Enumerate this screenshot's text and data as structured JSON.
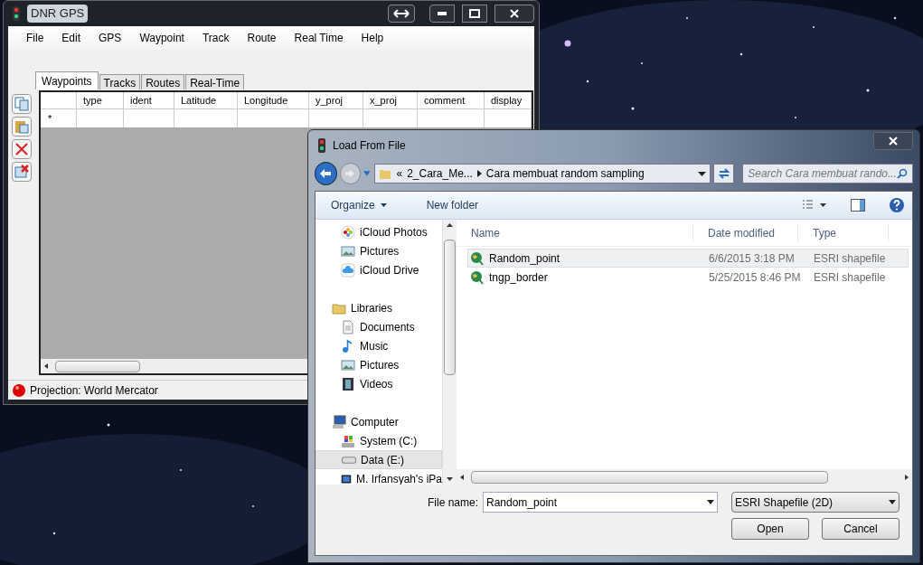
{
  "gps_window": {
    "title": "DNR GPS",
    "menu": [
      "File",
      "Edit",
      "GPS",
      "Waypoint",
      "Track",
      "Route",
      "Real Time",
      "Help"
    ],
    "tabs": [
      {
        "label": "Waypoints",
        "selected": true
      },
      {
        "label": "Tracks",
        "selected": false
      },
      {
        "label": "Routes",
        "selected": false
      },
      {
        "label": "Real-Time",
        "selected": false
      }
    ],
    "table": {
      "columns": [
        "type",
        "ident",
        "Latitude",
        "Longitude",
        "y_proj",
        "x_proj",
        "comment",
        "display"
      ],
      "new_row_marker": "*"
    },
    "status_bar": "Projection: World Mercator"
  },
  "dialog": {
    "title": "Load From File",
    "breadcrumb": {
      "overflow": "«",
      "parent": "2_Cara_Me...",
      "current": "Cara membuat random sampling"
    },
    "search": {
      "placeholder": "Search Cara membuat rando..."
    },
    "toolbar": [
      "Organize",
      "New folder"
    ],
    "nav": [
      {
        "label": "iCloud Photos",
        "kind": "photos",
        "selected": false
      },
      {
        "label": "Pictures",
        "kind": "pictures",
        "selected": false
      },
      {
        "label": "iCloud Drive",
        "kind": "cloud",
        "selected": false
      },
      {
        "label": "Libraries",
        "kind": "library",
        "selected": false
      },
      {
        "label": "Documents",
        "kind": "documents",
        "selected": false
      },
      {
        "label": "Music",
        "kind": "music",
        "selected": false
      },
      {
        "label": "Pictures",
        "kind": "pictures",
        "selected": false
      },
      {
        "label": "Videos",
        "kind": "videos",
        "selected": false
      },
      {
        "label": "Computer",
        "kind": "computer",
        "selected": false
      },
      {
        "label": "System (C:)",
        "kind": "system",
        "selected": false
      },
      {
        "label": "Data (E:)",
        "kind": "disk",
        "selected": true
      },
      {
        "label": "M. Irfansyah's iPa",
        "kind": "device",
        "selected": false
      }
    ],
    "columns": [
      "Name",
      "Date modified",
      "Type"
    ],
    "files": [
      {
        "name": "Random_point",
        "date": "6/6/2015 3:18 PM",
        "type": "ESRI shapefile",
        "selected": true
      },
      {
        "name": "tngp_border",
        "date": "5/25/2015 8:46 PM",
        "type": "ESRI shapefile",
        "selected": false
      }
    ],
    "file_name_label": "File name:",
    "file_name": "Random_point",
    "file_type": "ESRI Shapefile (2D)",
    "buttons": [
      "Open",
      "Cancel"
    ]
  }
}
